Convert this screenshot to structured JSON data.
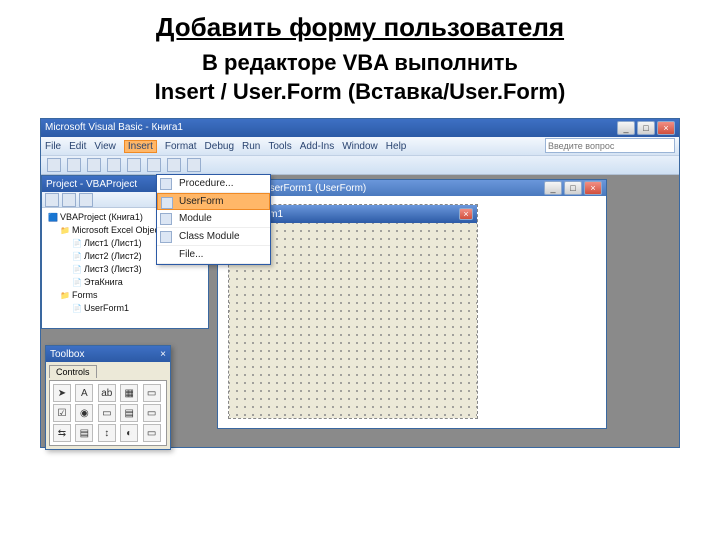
{
  "slide": {
    "title": "Добавить форму пользователя",
    "subtitle_line1": "В редакторе VBA выполнить",
    "subtitle_line2": "Insert / User.Form   (Вставка/User.Form)"
  },
  "vb": {
    "title": "Microsoft Visual Basic - Книга1",
    "menus": [
      "File",
      "Edit",
      "View",
      "Insert",
      "Format",
      "Debug",
      "Run",
      "Tools",
      "Add-Ins",
      "Window",
      "Help"
    ],
    "help_placeholder": "Введите вопрос"
  },
  "project": {
    "panel_title": "Project - VBAProject",
    "root": "VBAProject (Книга1)",
    "folder1": "Microsoft Excel Objects",
    "sheets": [
      "Лист1 (Лист1)",
      "Лист2 (Лист2)",
      "Лист3 (Лист3)",
      "ЭтаКнига"
    ],
    "folder2": "Forms",
    "form_item": "UserForm1"
  },
  "insert_menu": {
    "items": [
      "Procedure...",
      "UserForm",
      "Module",
      "Class Module",
      "File..."
    ],
    "selected_index": 1
  },
  "form_window": {
    "caption": "Книга1 - UserForm1 (UserForm)",
    "uf_caption": "UserForm1"
  },
  "toolbox": {
    "title": "Toolbox",
    "tab": "Controls",
    "items": [
      "▭",
      "A",
      "ab",
      "▦",
      "☑",
      "◉",
      "▭",
      "▤",
      "⇆",
      "↕",
      "◐",
      "▭",
      "▭",
      "▭",
      "▭"
    ]
  }
}
